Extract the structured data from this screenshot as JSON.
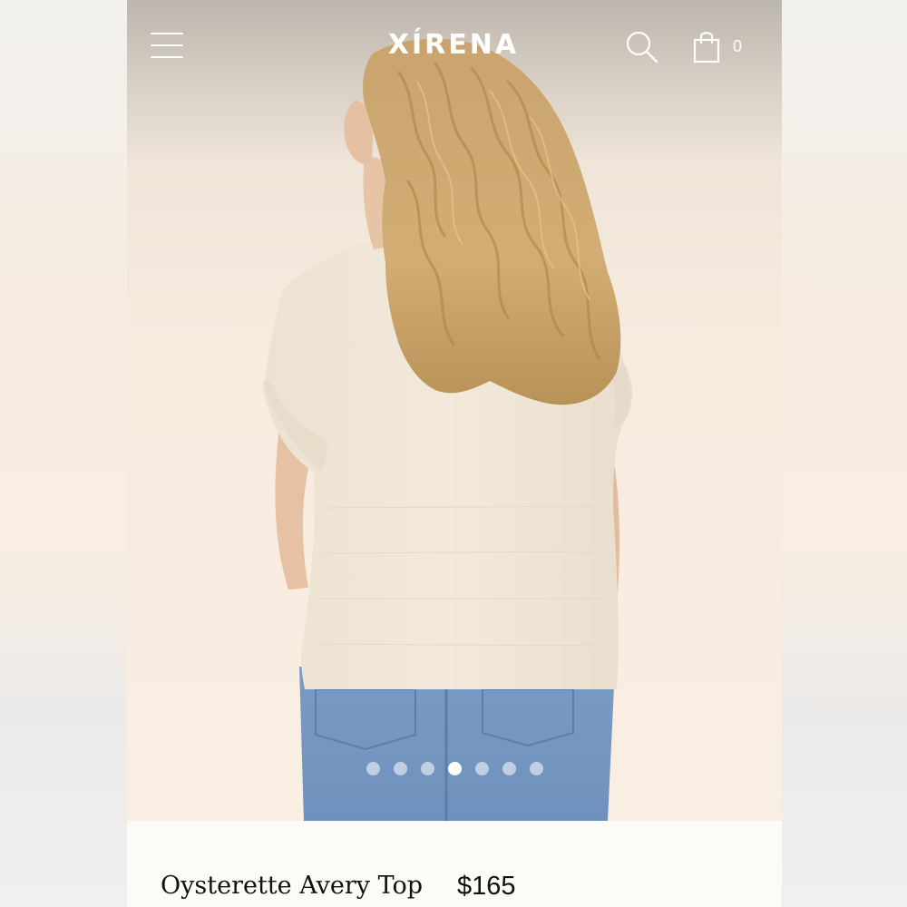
{
  "header": {
    "brand": "XÍRENA",
    "menu_icon": "hamburger-menu-icon",
    "search_icon": "search-icon",
    "cart_icon": "shopping-bag-icon",
    "cart_count": "0"
  },
  "gallery": {
    "image_count": 7,
    "active_index": 3
  },
  "product": {
    "name": "Oysterette Avery Top",
    "price": "$165"
  },
  "colors": {
    "header_text": "#ffffff",
    "product_text": "#111111",
    "background": "#f8eee3"
  }
}
